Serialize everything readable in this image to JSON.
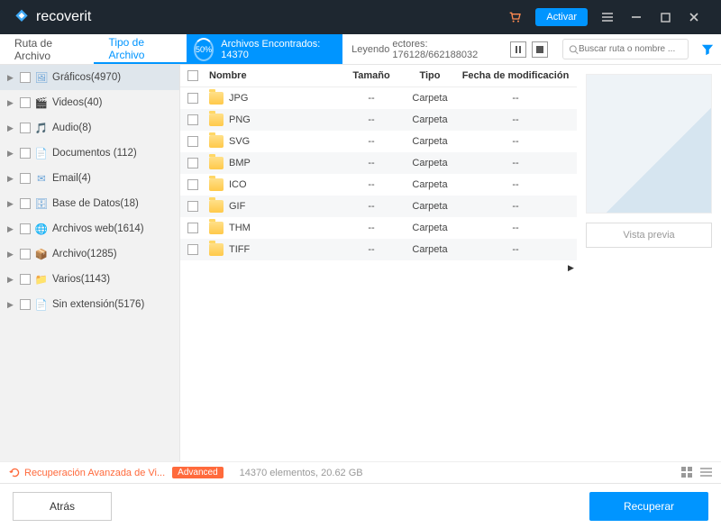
{
  "app": {
    "name": "recoverit",
    "activate_label": "Activar"
  },
  "tabs": {
    "path": "Ruta de Archivo",
    "type": "Tipo de Archivo"
  },
  "scan": {
    "percent": "50%",
    "found_label": "Archivos Encontrados: 14370",
    "reading_label": "Leyendo",
    "reading_detail": "ectores: 176128/662188032"
  },
  "search": {
    "placeholder": "Buscar ruta o nombre ..."
  },
  "sidebar": [
    {
      "label": "Gráficos(4970)"
    },
    {
      "label": "Videos(40)"
    },
    {
      "label": "Audio(8)"
    },
    {
      "label": "Documentos  (112)"
    },
    {
      "label": "Email(4)"
    },
    {
      "label": "Base de Datos(18)"
    },
    {
      "label": "Archivos web(1614)"
    },
    {
      "label": "Archivo(1285)"
    },
    {
      "label": "Varios(1143)"
    },
    {
      "label": "Sin extensión(5176)"
    }
  ],
  "columns": {
    "name": "Nombre",
    "size": "Tamaño",
    "type": "Tipo",
    "date": "Fecha de modificación"
  },
  "rows": [
    {
      "name": "JPG",
      "size": "--",
      "type": "Carpeta",
      "date": "--"
    },
    {
      "name": "PNG",
      "size": "--",
      "type": "Carpeta",
      "date": "--"
    },
    {
      "name": "SVG",
      "size": "--",
      "type": "Carpeta",
      "date": "--"
    },
    {
      "name": "BMP",
      "size": "--",
      "type": "Carpeta",
      "date": "--"
    },
    {
      "name": "ICO",
      "size": "--",
      "type": "Carpeta",
      "date": "--"
    },
    {
      "name": "GIF",
      "size": "--",
      "type": "Carpeta",
      "date": "--"
    },
    {
      "name": "THM",
      "size": "--",
      "type": "Carpeta",
      "date": "--"
    },
    {
      "name": "TIFF",
      "size": "--",
      "type": "Carpeta",
      "date": "--"
    }
  ],
  "preview": {
    "button": "Vista previa"
  },
  "advanced": {
    "link": "Recuperación Avanzada de Vi...",
    "badge": "Advanced"
  },
  "status": {
    "text": "14370 elementos, 20.62  GB"
  },
  "footer": {
    "back": "Atrás",
    "recover": "Recuperar"
  }
}
